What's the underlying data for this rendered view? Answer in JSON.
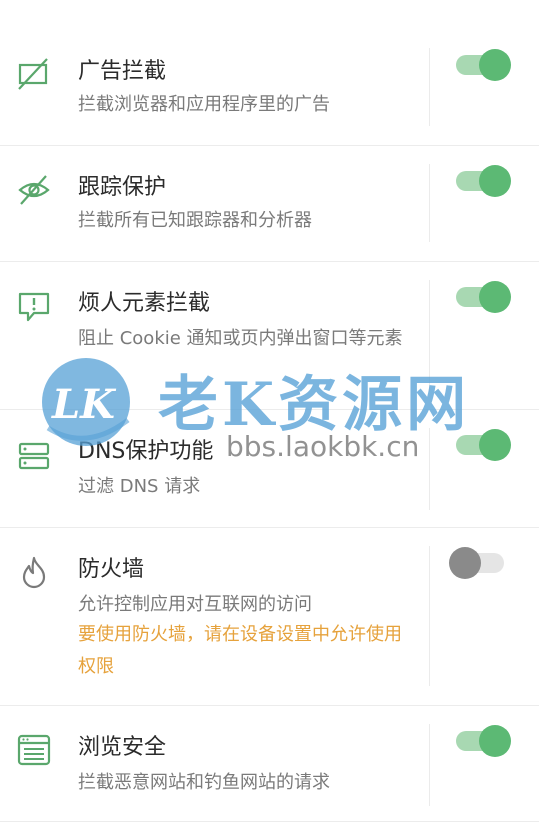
{
  "colors": {
    "accent": "#5cb974",
    "accent_track": "#a8d8b2",
    "warning": "#e6a23c",
    "icon_green": "#5aa76c"
  },
  "settings": [
    {
      "icon": "ad-block-icon",
      "title": "广告拦截",
      "desc": "拦截浏览器和应用程序里的广告",
      "enabled": true
    },
    {
      "icon": "eye-off-icon",
      "title": "跟踪保护",
      "desc": "拦截所有已知跟踪器和分析器",
      "enabled": true
    },
    {
      "icon": "alert-message-icon",
      "title": "烦人元素拦截",
      "desc": "阻止 Cookie 通知或页内弹出窗口等元素",
      "enabled": true
    },
    {
      "icon": "dns-server-icon",
      "title": "DNS保护功能",
      "desc": "过滤 DNS 请求",
      "enabled": true
    },
    {
      "icon": "flame-icon",
      "title": "防火墙",
      "desc": "允许控制应用对互联网的访问",
      "warning": "要使用防火墙，请在设备设置中允许使用权限",
      "enabled": false
    },
    {
      "icon": "browser-window-icon",
      "title": "浏览安全",
      "desc": "拦截恶意网站和钓鱼网站的请求",
      "enabled": true
    }
  ],
  "watermark": {
    "logo_text": "LK",
    "text": "老K资源网",
    "url": "bbs.laokbk.cn"
  }
}
